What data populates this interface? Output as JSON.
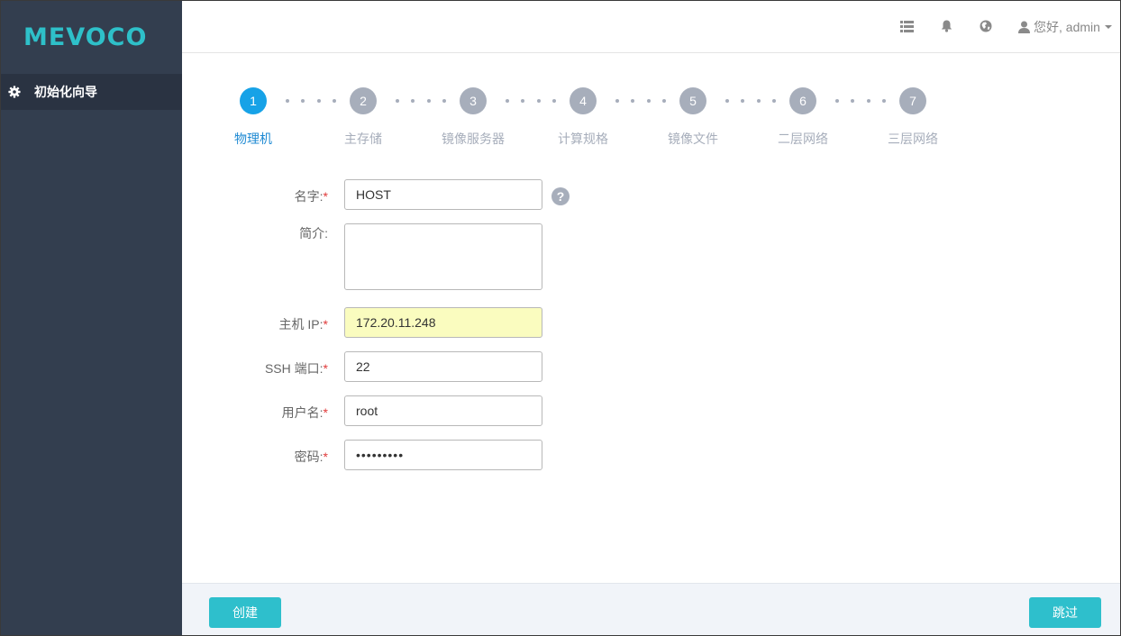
{
  "sidebar": {
    "logo": "MEVOCO",
    "items": [
      {
        "label": "初始化向导",
        "icon": "gear-icon"
      }
    ]
  },
  "topbar": {
    "icons": [
      "list-icon",
      "bell-icon",
      "globe-icon"
    ],
    "user_label": "您好, admin",
    "user_icon": "user-icon"
  },
  "steps": [
    {
      "number": "1",
      "label": "物理机",
      "active": true
    },
    {
      "number": "2",
      "label": "主存储",
      "active": false
    },
    {
      "number": "3",
      "label": "镜像服务器",
      "active": false
    },
    {
      "number": "4",
      "label": "计算规格",
      "active": false
    },
    {
      "number": "5",
      "label": "镜像文件",
      "active": false
    },
    {
      "number": "6",
      "label": "二层网络",
      "active": false
    },
    {
      "number": "7",
      "label": "三层网络",
      "active": false
    }
  ],
  "form": {
    "name": {
      "label": "名字:",
      "required": "*",
      "value": "HOST",
      "help": "?"
    },
    "description": {
      "label": "简介:",
      "value": ""
    },
    "host_ip": {
      "label": "主机 IP:",
      "required": "*",
      "value": "172.20.11.248"
    },
    "ssh_port": {
      "label": "SSH 端口:",
      "required": "*",
      "value": "22"
    },
    "username": {
      "label": "用户名:",
      "required": "*",
      "value": "root"
    },
    "password": {
      "label": "密码:",
      "required": "*",
      "value": "•••••••••"
    }
  },
  "footer": {
    "create_label": "创建",
    "skip_label": "跳过"
  },
  "colors": {
    "accent": "#2ebfcc",
    "active_step": "#17a2e7",
    "sidebar_bg": "#333e4f",
    "required": "#e03b3b"
  }
}
